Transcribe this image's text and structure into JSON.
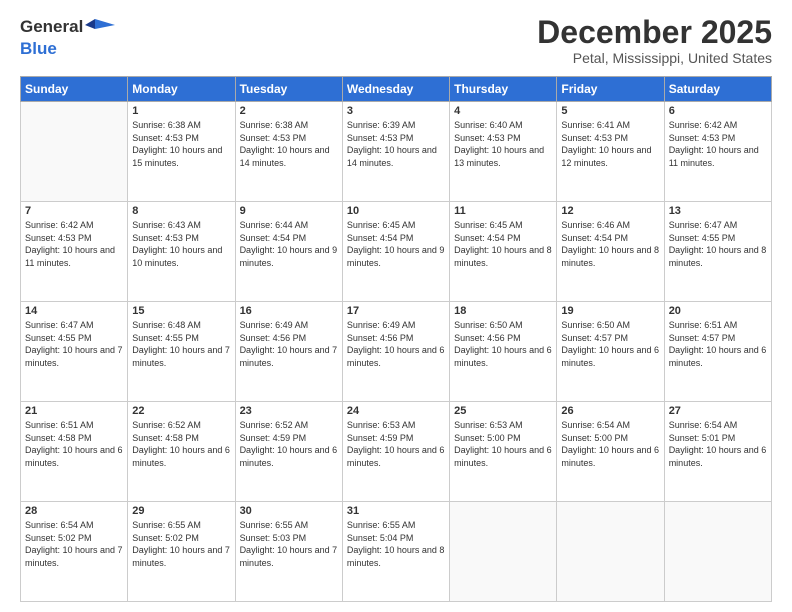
{
  "header": {
    "logo_general": "General",
    "logo_blue": "Blue",
    "title": "December 2025",
    "location": "Petal, Mississippi, United States"
  },
  "calendar": {
    "days_of_week": [
      "Sunday",
      "Monday",
      "Tuesday",
      "Wednesday",
      "Thursday",
      "Friday",
      "Saturday"
    ],
    "weeks": [
      [
        {
          "day": "",
          "sunrise": "",
          "sunset": "",
          "daylight": ""
        },
        {
          "day": "1",
          "sunrise": "Sunrise: 6:38 AM",
          "sunset": "Sunset: 4:53 PM",
          "daylight": "Daylight: 10 hours and 15 minutes."
        },
        {
          "day": "2",
          "sunrise": "Sunrise: 6:38 AM",
          "sunset": "Sunset: 4:53 PM",
          "daylight": "Daylight: 10 hours and 14 minutes."
        },
        {
          "day": "3",
          "sunrise": "Sunrise: 6:39 AM",
          "sunset": "Sunset: 4:53 PM",
          "daylight": "Daylight: 10 hours and 14 minutes."
        },
        {
          "day": "4",
          "sunrise": "Sunrise: 6:40 AM",
          "sunset": "Sunset: 4:53 PM",
          "daylight": "Daylight: 10 hours and 13 minutes."
        },
        {
          "day": "5",
          "sunrise": "Sunrise: 6:41 AM",
          "sunset": "Sunset: 4:53 PM",
          "daylight": "Daylight: 10 hours and 12 minutes."
        },
        {
          "day": "6",
          "sunrise": "Sunrise: 6:42 AM",
          "sunset": "Sunset: 4:53 PM",
          "daylight": "Daylight: 10 hours and 11 minutes."
        }
      ],
      [
        {
          "day": "7",
          "sunrise": "Sunrise: 6:42 AM",
          "sunset": "Sunset: 4:53 PM",
          "daylight": "Daylight: 10 hours and 11 minutes."
        },
        {
          "day": "8",
          "sunrise": "Sunrise: 6:43 AM",
          "sunset": "Sunset: 4:53 PM",
          "daylight": "Daylight: 10 hours and 10 minutes."
        },
        {
          "day": "9",
          "sunrise": "Sunrise: 6:44 AM",
          "sunset": "Sunset: 4:54 PM",
          "daylight": "Daylight: 10 hours and 9 minutes."
        },
        {
          "day": "10",
          "sunrise": "Sunrise: 6:45 AM",
          "sunset": "Sunset: 4:54 PM",
          "daylight": "Daylight: 10 hours and 9 minutes."
        },
        {
          "day": "11",
          "sunrise": "Sunrise: 6:45 AM",
          "sunset": "Sunset: 4:54 PM",
          "daylight": "Daylight: 10 hours and 8 minutes."
        },
        {
          "day": "12",
          "sunrise": "Sunrise: 6:46 AM",
          "sunset": "Sunset: 4:54 PM",
          "daylight": "Daylight: 10 hours and 8 minutes."
        },
        {
          "day": "13",
          "sunrise": "Sunrise: 6:47 AM",
          "sunset": "Sunset: 4:55 PM",
          "daylight": "Daylight: 10 hours and 8 minutes."
        }
      ],
      [
        {
          "day": "14",
          "sunrise": "Sunrise: 6:47 AM",
          "sunset": "Sunset: 4:55 PM",
          "daylight": "Daylight: 10 hours and 7 minutes."
        },
        {
          "day": "15",
          "sunrise": "Sunrise: 6:48 AM",
          "sunset": "Sunset: 4:55 PM",
          "daylight": "Daylight: 10 hours and 7 minutes."
        },
        {
          "day": "16",
          "sunrise": "Sunrise: 6:49 AM",
          "sunset": "Sunset: 4:56 PM",
          "daylight": "Daylight: 10 hours and 7 minutes."
        },
        {
          "day": "17",
          "sunrise": "Sunrise: 6:49 AM",
          "sunset": "Sunset: 4:56 PM",
          "daylight": "Daylight: 10 hours and 6 minutes."
        },
        {
          "day": "18",
          "sunrise": "Sunrise: 6:50 AM",
          "sunset": "Sunset: 4:56 PM",
          "daylight": "Daylight: 10 hours and 6 minutes."
        },
        {
          "day": "19",
          "sunrise": "Sunrise: 6:50 AM",
          "sunset": "Sunset: 4:57 PM",
          "daylight": "Daylight: 10 hours and 6 minutes."
        },
        {
          "day": "20",
          "sunrise": "Sunrise: 6:51 AM",
          "sunset": "Sunset: 4:57 PM",
          "daylight": "Daylight: 10 hours and 6 minutes."
        }
      ],
      [
        {
          "day": "21",
          "sunrise": "Sunrise: 6:51 AM",
          "sunset": "Sunset: 4:58 PM",
          "daylight": "Daylight: 10 hours and 6 minutes."
        },
        {
          "day": "22",
          "sunrise": "Sunrise: 6:52 AM",
          "sunset": "Sunset: 4:58 PM",
          "daylight": "Daylight: 10 hours and 6 minutes."
        },
        {
          "day": "23",
          "sunrise": "Sunrise: 6:52 AM",
          "sunset": "Sunset: 4:59 PM",
          "daylight": "Daylight: 10 hours and 6 minutes."
        },
        {
          "day": "24",
          "sunrise": "Sunrise: 6:53 AM",
          "sunset": "Sunset: 4:59 PM",
          "daylight": "Daylight: 10 hours and 6 minutes."
        },
        {
          "day": "25",
          "sunrise": "Sunrise: 6:53 AM",
          "sunset": "Sunset: 5:00 PM",
          "daylight": "Daylight: 10 hours and 6 minutes."
        },
        {
          "day": "26",
          "sunrise": "Sunrise: 6:54 AM",
          "sunset": "Sunset: 5:00 PM",
          "daylight": "Daylight: 10 hours and 6 minutes."
        },
        {
          "day": "27",
          "sunrise": "Sunrise: 6:54 AM",
          "sunset": "Sunset: 5:01 PM",
          "daylight": "Daylight: 10 hours and 6 minutes."
        }
      ],
      [
        {
          "day": "28",
          "sunrise": "Sunrise: 6:54 AM",
          "sunset": "Sunset: 5:02 PM",
          "daylight": "Daylight: 10 hours and 7 minutes."
        },
        {
          "day": "29",
          "sunrise": "Sunrise: 6:55 AM",
          "sunset": "Sunset: 5:02 PM",
          "daylight": "Daylight: 10 hours and 7 minutes."
        },
        {
          "day": "30",
          "sunrise": "Sunrise: 6:55 AM",
          "sunset": "Sunset: 5:03 PM",
          "daylight": "Daylight: 10 hours and 7 minutes."
        },
        {
          "day": "31",
          "sunrise": "Sunrise: 6:55 AM",
          "sunset": "Sunset: 5:04 PM",
          "daylight": "Daylight: 10 hours and 8 minutes."
        },
        {
          "day": "",
          "sunrise": "",
          "sunset": "",
          "daylight": ""
        },
        {
          "day": "",
          "sunrise": "",
          "sunset": "",
          "daylight": ""
        },
        {
          "day": "",
          "sunrise": "",
          "sunset": "",
          "daylight": ""
        }
      ]
    ]
  }
}
